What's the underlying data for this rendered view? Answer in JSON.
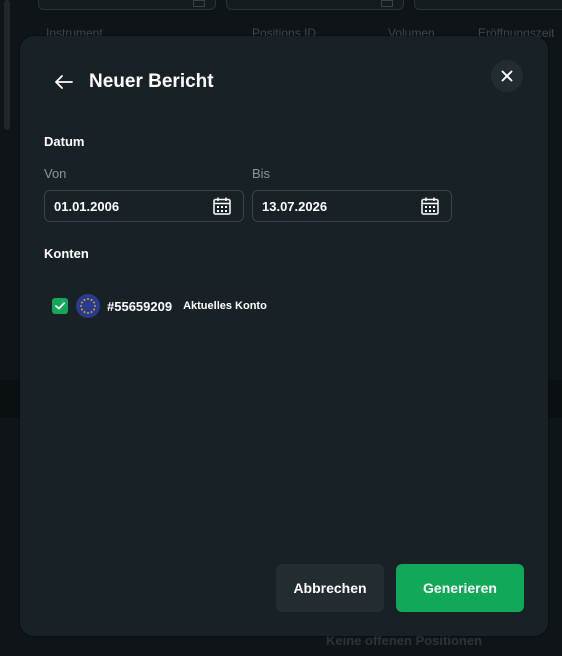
{
  "background": {
    "columns": [
      "Instrument",
      "Positions ID",
      "Volumen",
      "Eröffnungszeit"
    ],
    "empty_message": "Keine offenen Positionen"
  },
  "dialog": {
    "title": "Neuer Bericht",
    "back_icon": "arrow-left-icon",
    "close_icon": "close-icon",
    "date_section": {
      "label": "Datum",
      "from_label": "Von",
      "from_value": "01.01.2006",
      "to_label": "Bis",
      "to_value": "13.07.2026",
      "calendar_icon": "calendar-icon"
    },
    "accounts_section": {
      "label": "Konten",
      "accounts": [
        {
          "checked": true,
          "flag": "eu-flag-icon",
          "number": "#55659209",
          "tag": "Aktuelles Konto"
        }
      ]
    },
    "buttons": {
      "cancel": "Abbrechen",
      "generate": "Generieren"
    }
  },
  "colors": {
    "accent_green": "#11a85a",
    "modal_bg": "#182226",
    "secondary_button": "#222c31",
    "eu_blue": "#2a3b8f",
    "eu_stars": "#f2c300"
  }
}
